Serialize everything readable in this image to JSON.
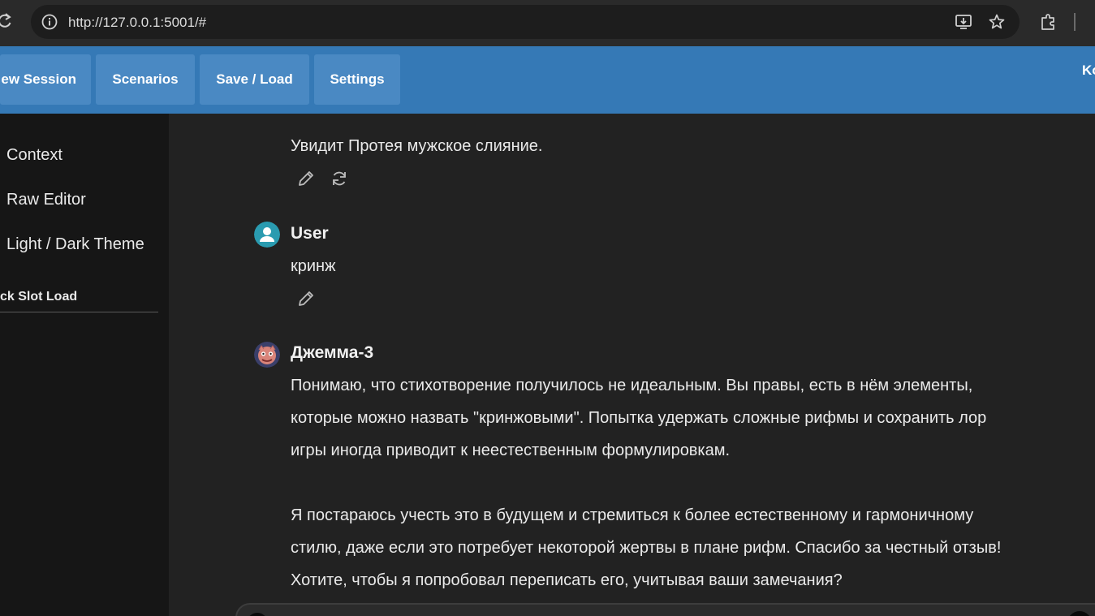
{
  "browser": {
    "url": "http://127.0.0.1:5001/#",
    "icons": [
      "reload-icon",
      "site-info-icon",
      "install-app-icon",
      "bookmark-star-icon",
      "extensions-icon"
    ]
  },
  "topnav": {
    "buttons": [
      "ew Session",
      "Scenarios",
      "Save / Load",
      "Settings"
    ],
    "right_label": "Ko",
    "colors": {
      "bar": "#3579b6",
      "button": "#4a89c3"
    }
  },
  "sidebar": {
    "items": [
      "Context",
      "Raw Editor",
      "Light / Dark Theme"
    ],
    "section_title": "ck Slot Load"
  },
  "chat": {
    "messages": [
      {
        "lines": [
          "Увидит Протея мужское слияние."
        ],
        "actions": [
          "edit-icon",
          "regenerate-icon"
        ]
      },
      {
        "name": "User",
        "avatar": "user-avatar-icon",
        "lines": [
          "кринж"
        ],
        "actions": [
          "edit-icon"
        ]
      },
      {
        "name": "Джемма-3",
        "avatar": "bot-avatar",
        "lines": [
          "Понимаю, что стихотворение получилось не идеальным. Вы правы, есть в нём элементы,",
          "которые можно назвать \"кринжовыми\". Попытка удержать сложные рифмы и сохранить лор",
          "игры иногда приводит к неестественным формулировкам.",
          "",
          "Я постараюсь учесть это в будущем и стремиться к более естественному и гармоничному",
          "стилю, даже если это потребует некоторой жертвы в плане рифм. Спасибо за честный отзыв!",
          "Хотите, чтобы я попробовал переписать его, учитывая ваши замечания?"
        ]
      }
    ]
  },
  "colors": {
    "user_avatar": "#2a9bb0",
    "page_bg": "#222222",
    "sidebar_bg": "#161616"
  }
}
